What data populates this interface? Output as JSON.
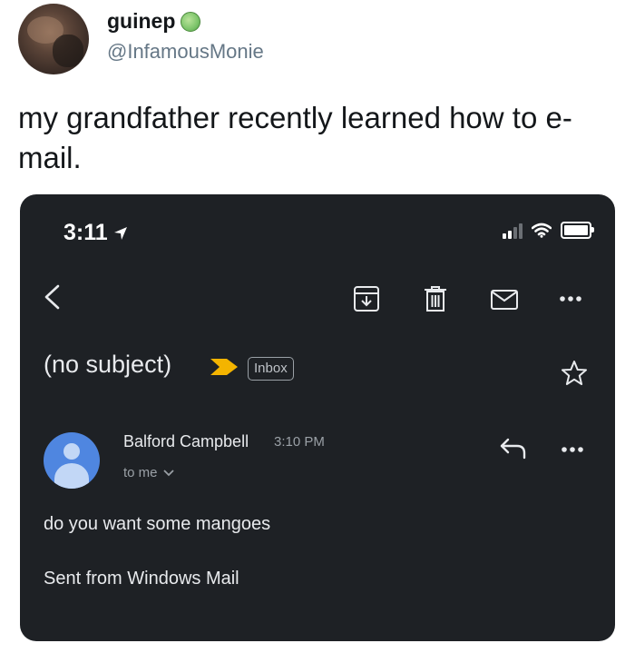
{
  "tweet": {
    "display_name": "guinep",
    "handle": "@InfamousMonie",
    "text": "my grandfather recently learned how to e-mail."
  },
  "status_bar": {
    "time": "3:11"
  },
  "email": {
    "subject": "(no subject)",
    "label": "Inbox",
    "sender": "Balford Campbell",
    "time": "3:10 PM",
    "recipient": "to me",
    "body_lines": [
      "do you want some mangoes",
      "Sent from Windows Mail"
    ]
  },
  "icons": {
    "status": [
      "location-arrow-icon",
      "signal-icon",
      "wifi-icon",
      "battery-icon"
    ],
    "toolbar": [
      "back-icon",
      "archive-icon",
      "trash-icon",
      "mark-unread-icon",
      "more-icon"
    ],
    "message": [
      "importance-marker-icon",
      "star-icon",
      "reply-icon",
      "more-icon",
      "chevron-down-icon"
    ]
  },
  "colors": {
    "phone_bg": "#1e2125",
    "sender_avatar": "#4f86e0",
    "importance": "#f4b400"
  }
}
